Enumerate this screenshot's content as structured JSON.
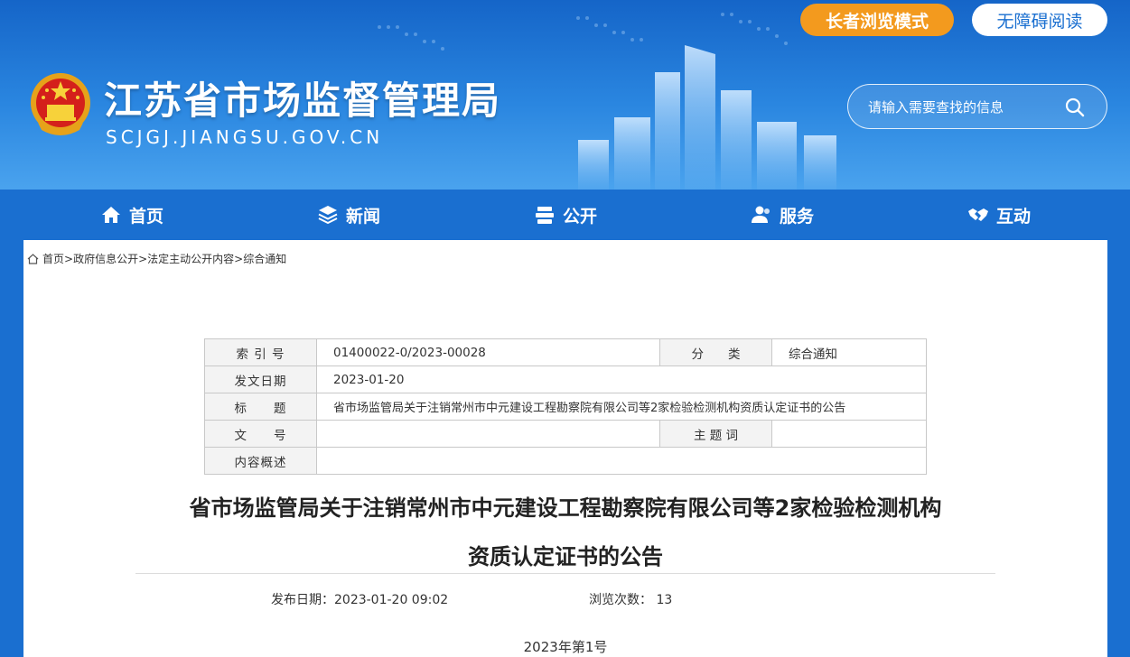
{
  "header": {
    "site_title": "江苏省市场监督管理局",
    "site_domain": "SCJGJ.JIANGSU.GOV.CN",
    "elder_mode_label": "长者浏览模式",
    "accessible_label": "无障碍阅读",
    "search_placeholder": "请输入需要查找的信息",
    "colors": {
      "primary": "#1a6fd0",
      "accent": "#f39a1e"
    }
  },
  "nav": {
    "items": [
      {
        "label": "首页",
        "icon": "home-icon"
      },
      {
        "label": "新闻",
        "icon": "layers-icon"
      },
      {
        "label": "公开",
        "icon": "stack-icon"
      },
      {
        "label": "服务",
        "icon": "users-icon"
      },
      {
        "label": "互动",
        "icon": "handshake-icon"
      }
    ]
  },
  "breadcrumb": {
    "items": [
      "首页",
      "政府信息公开",
      "法定主动公开内容",
      "综合通知"
    ],
    "separator": ">"
  },
  "meta": {
    "index_label": "索 引 号",
    "index_value": "01400022-0/2023-00028",
    "category_label": "分　　类",
    "category_value": "综合通知",
    "date_label": "发文日期",
    "date_value": "2023-01-20",
    "title_label": "标　　题",
    "title_value": "省市场监管局关于注销常州市中元建设工程勘察院有限公司等2家检验检测机构资质认定证书的公告",
    "docnum_label": "文　　号",
    "docnum_value": "",
    "keyword_label": "主 题 词",
    "keyword_value": "",
    "summary_label": "内容概述",
    "summary_value": ""
  },
  "article": {
    "title_line1": "省市场监管局关于注销常州市中元建设工程勘察院有限公司等2家检验检测机构",
    "title_line2": "资质认定证书的公告",
    "pub_date": "发布日期：2023-01-20 09:02",
    "views": "浏览次数：  13",
    "doc_no": "2023年第1号"
  }
}
